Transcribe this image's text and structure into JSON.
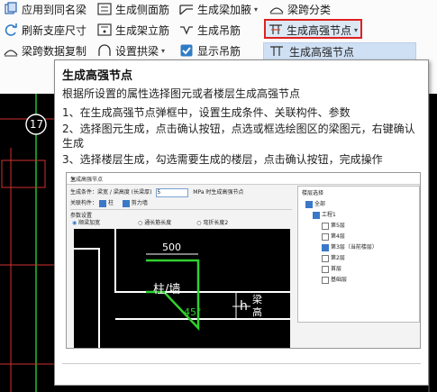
{
  "ribbon": {
    "row1": [
      {
        "name": "apply-same-beam-button",
        "label": "应用到同名梁",
        "icon": "copy-beam-icon"
      },
      {
        "name": "gen-side-rebar-button",
        "label": "生成侧面筋",
        "icon": "side-rebar-icon"
      },
      {
        "name": "gen-haunch-button",
        "label": "生成梁加腋",
        "icon": "haunch-icon",
        "dropdown": true
      },
      {
        "name": "span-classify-button",
        "label": "梁跨分类",
        "icon": "span-icon"
      }
    ],
    "row2": [
      {
        "name": "refresh-support-button",
        "label": "刷新支座尺寸",
        "icon": "refresh-icon"
      },
      {
        "name": "gen-stirrup-button",
        "label": "生成架立筋",
        "icon": "stirrup-icon"
      },
      {
        "name": "gen-hanger-button",
        "label": "生成吊筋",
        "icon": "hanger-icon"
      },
      {
        "name": "gen-strong-node-button",
        "label": "生成高强节点",
        "icon": "strong-node-icon",
        "dropdown": true
      }
    ],
    "row3": [
      {
        "name": "copy-span-data-button",
        "label": "梁跨数据复制",
        "icon": "copy-span-icon"
      },
      {
        "name": "set-arch-beam-button",
        "label": "设置拱梁",
        "icon": "arch-icon",
        "dropdown": true
      },
      {
        "name": "show-hanger-checkbox",
        "label": "显示吊筋",
        "icon": "checkbox-icon"
      }
    ],
    "dropdown_item": "生成高强节点"
  },
  "cad": {
    "axis_label": "17"
  },
  "tooltip": {
    "title": "生成高强节点",
    "subtitle": "根据所设置的属性选择图元或者楼层生成高强节点",
    "steps": [
      "1、在生成高强节点弹框中，设置生成条件、关联构件、参数",
      "2、选择图元生成，点击确认按钮，点选或框选绘图区的梁图元，右键确认生成",
      "3、选择楼层生成，勾选需要生成的楼层，点击确认按钮，完成操作"
    ]
  },
  "preview": {
    "title": "生成高强节点",
    "cond_label": "生成条件：",
    "cond_text": "梁宽 / 梁高度 (长梁厚)",
    "cond_value": "5",
    "cond_suffix": "MPa 时生成高强节点",
    "assoc_label": "关联构件：",
    "assoc_col": "柱",
    "assoc_shear": "剪力墙",
    "param_label": "参数设置",
    "radio1": "顺梁加宽",
    "radio2": "通长筋长度",
    "radio3": "弯折长度2",
    "tree_header": "楼层选择",
    "tree_root": "全部",
    "tree_proj": "工程1",
    "floors": [
      {
        "label": "第5层",
        "checked": false
      },
      {
        "label": "第4层",
        "checked": false
      },
      {
        "label": "第3层（当前楼层）",
        "checked": true
      },
      {
        "label": "第2层",
        "checked": false
      },
      {
        "label": "首层",
        "checked": false
      },
      {
        "label": "基础层",
        "checked": false
      }
    ],
    "draw_500": "500",
    "draw_col": "柱/墙",
    "draw_45": "45°",
    "draw_h": "h",
    "draw_beam": "梁",
    "draw_high": "高"
  }
}
